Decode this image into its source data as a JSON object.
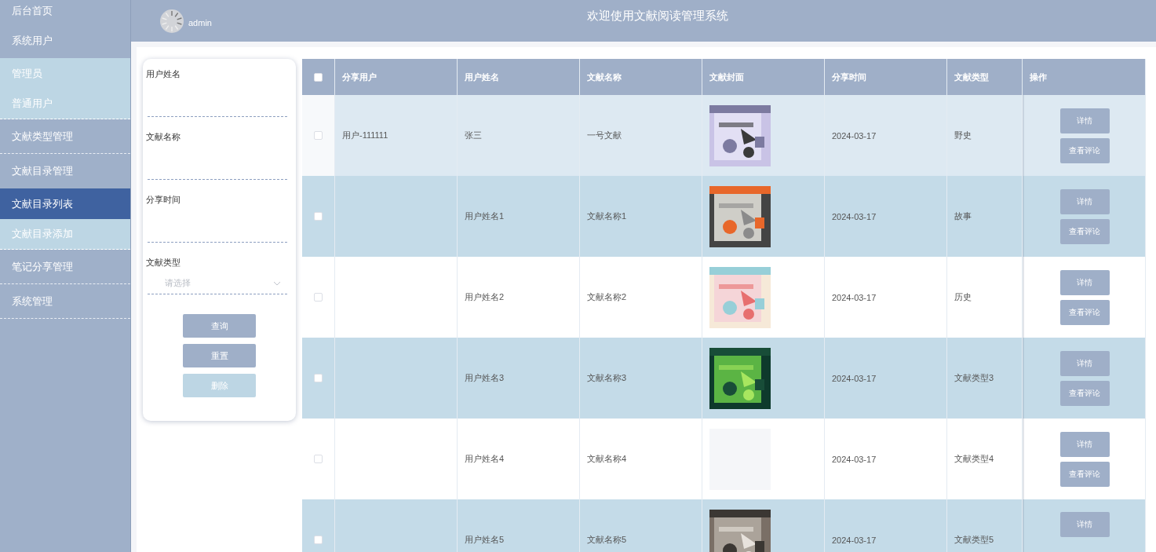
{
  "sidebar": {
    "items": [
      {
        "label": "后台首页",
        "kind": "main",
        "selected": false
      },
      {
        "label": "系统用户",
        "kind": "main",
        "selected": false
      },
      {
        "label": "管理员",
        "kind": "sub",
        "selected": false
      },
      {
        "label": "普通用户",
        "kind": "sub",
        "selected": false
      },
      {
        "label": "文献类型管理",
        "kind": "main",
        "selected": false
      },
      {
        "label": "文献目录管理",
        "kind": "main",
        "selected": false
      },
      {
        "label": "文献目录列表",
        "kind": "sub",
        "selected": true
      },
      {
        "label": "文献目录添加",
        "kind": "sub",
        "selected": false
      },
      {
        "label": "笔记分享管理",
        "kind": "main",
        "selected": false
      },
      {
        "label": "系统管理",
        "kind": "main",
        "selected": false
      }
    ]
  },
  "header": {
    "user": "admin",
    "title": "欢迎使用文献阅读管理系统"
  },
  "search": {
    "fields": [
      {
        "label": "用户姓名",
        "kind": "text"
      },
      {
        "label": "文献名称",
        "kind": "text"
      },
      {
        "label": "分享时间",
        "kind": "text"
      },
      {
        "label": "文献类型",
        "kind": "select",
        "placeholder": "请选择"
      }
    ],
    "buttons": [
      {
        "label": "查询",
        "disabled": false
      },
      {
        "label": "重置",
        "disabled": false
      },
      {
        "label": "删除",
        "disabled": true
      }
    ]
  },
  "table": {
    "header_checked": false,
    "columns": [
      "分享用户",
      "用户姓名",
      "文献名称",
      "文献封面",
      "分享时间",
      "文献类型",
      "操作"
    ],
    "rows": [
      {
        "checked": false,
        "highlighted": true,
        "share_user": "用户-111111",
        "user_name": "张三",
        "doc_name": "一号文献",
        "cover": {
          "kind": "picture"
        },
        "share_time": "2024-03-17",
        "doc_type": "野史",
        "actions": [
          "详情",
          "查看评论"
        ]
      },
      {
        "checked": false,
        "highlighted": false,
        "user_name": "用户姓名1",
        "doc_name": "文献名称1",
        "cover": {
          "kind": "picture"
        },
        "share_time": "2024-03-17",
        "doc_type": "故事",
        "actions": [
          "详情",
          "查看评论"
        ]
      },
      {
        "checked": false,
        "highlighted": false,
        "user_name": "用户姓名2",
        "doc_name": "文献名称2",
        "cover": {
          "kind": "picture"
        },
        "share_time": "2024-03-17",
        "doc_type": "历史",
        "actions": [
          "详情",
          "查看评论"
        ]
      },
      {
        "checked": false,
        "highlighted": false,
        "user_name": "用户姓名3",
        "doc_name": "文献名称3",
        "cover": {
          "kind": "picture"
        },
        "share_time": "2024-03-17",
        "doc_type": "文献类型3",
        "actions": [
          "详情",
          "查看评论"
        ]
      },
      {
        "checked": false,
        "highlighted": false,
        "user_name": "用户姓名4",
        "doc_name": "文献名称4",
        "cover": {
          "kind": "empty"
        },
        "share_time": "2024-03-17",
        "doc_type": "文献类型4",
        "actions": [
          "详情",
          "查看评论"
        ]
      },
      {
        "checked": false,
        "highlighted": false,
        "user_name": "用户姓名5",
        "doc_name": "文献名称5",
        "cover": {
          "kind": "picture"
        },
        "share_time": "2024-03-17",
        "doc_type": "文献类型5",
        "actions": [
          "详情"
        ]
      }
    ]
  }
}
